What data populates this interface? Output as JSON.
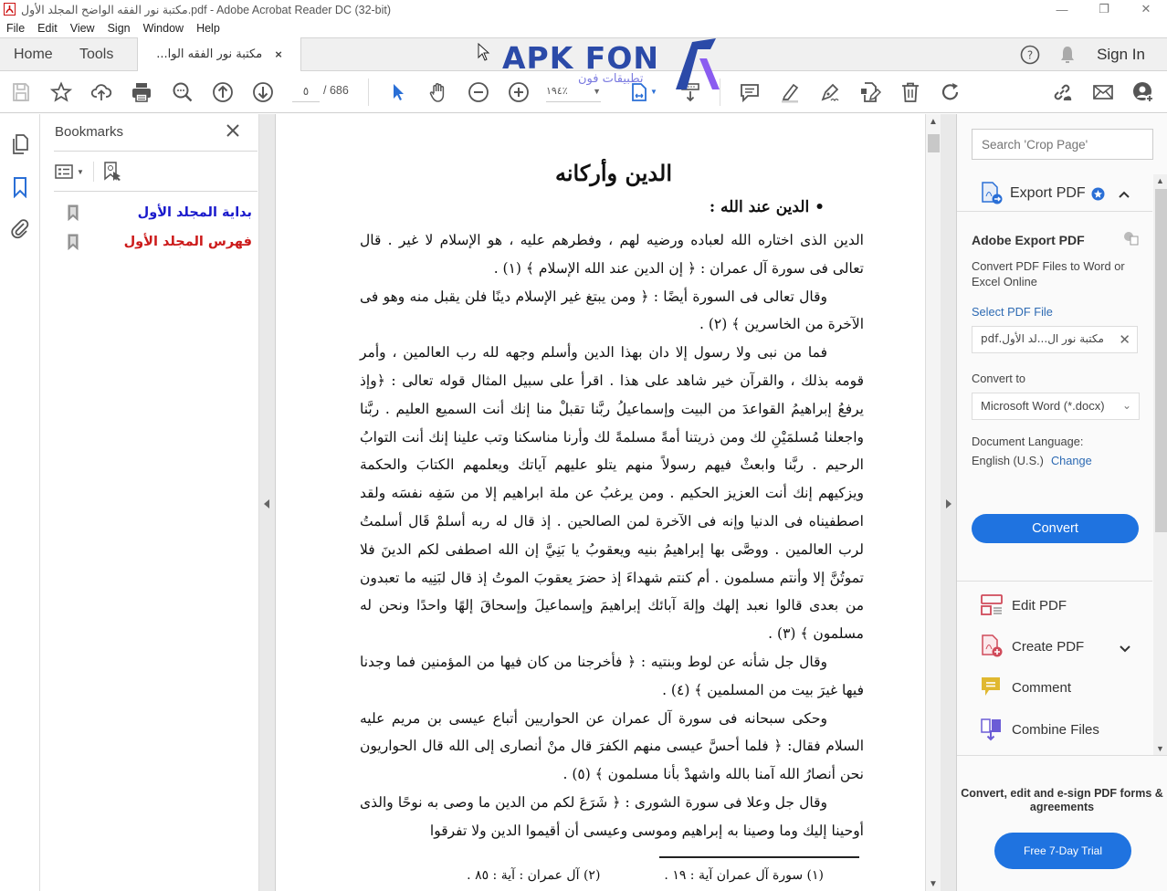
{
  "window": {
    "title": "مكتبة نور الفقه الواضح المجلد الأول.pdf - Adobe Acrobat Reader DC (32-bit)",
    "minimize": "—",
    "restore": "❐",
    "close": "✕"
  },
  "menu": [
    "File",
    "Edit",
    "View",
    "Sign",
    "Window",
    "Help"
  ],
  "tabs": {
    "home": "Home",
    "tools": "Tools",
    "document_tab": "مكتبة نور الفقه الوا...",
    "close": "×",
    "sign_in": "Sign In"
  },
  "toolbar": {
    "page_current": "٥",
    "page_total": "/ 686",
    "zoom_value": "١٩٤٪",
    "icons": [
      "save-icon",
      "bookmark-star-icon",
      "upload-cloud-icon",
      "print-icon",
      "find-icon",
      "page-up-icon",
      "page-down-icon",
      "select-arrow-icon",
      "hand-icon",
      "zoom-out-icon",
      "zoom-in-icon",
      "fit-page-icon",
      "scroll-mode-icon",
      "comment-icon",
      "highlight-icon",
      "sign-pen-icon",
      "edit-page-icon",
      "trash-icon",
      "rotate-icon",
      "share-link-icon",
      "email-icon",
      "add-user-icon"
    ]
  },
  "watermark": {
    "text": "APK FON",
    "subtext": "تطبيقات فون"
  },
  "bookmarks": {
    "title": "Bookmarks",
    "items": [
      {
        "label": "بداية المجلد الأول",
        "color": "#1a1acc"
      },
      {
        "label": "فهرس المجلد الأول",
        "color": "#cc1a1a"
      }
    ]
  },
  "document": {
    "heading": "الدين وأركانه",
    "subheading": "• الدين عند الله :",
    "paragraphs": [
      "الدين الذى اختاره الله لعباده ورضيه لهم ، وفطرهم عليه ، هو الإسلام لا غير . قال تعالى فى سورة آل عمران : ﴿ إن الدين عند الله الإسلام ﴾ (١) .",
      "وقال تعالى فى السورة أيضًا : ﴿ ومن يبتغ غير الإسلام دينًا فلن يقبل منه وهو فى الآخرة من الخاسرين ﴾ (٢) .",
      "فما من نبى ولا رسول إلا دان بهذا الدين وأسلم وجهه لله رب العالمين ، وأمر قومه بذلك ، والقرآن خير شاهد على هذا . اقرأ على سبيل المثال قوله تعالى : ﴿وإذ يرفعُ إبراهيمُ القواعدَ من البيت وإسماعيلُ ربَّنا تقبلْ منا إنك أنت السميع العليم . ربَّنا واجعلنا مُسلمَيْنِ لك ومن ذريتنا أمةً مسلمةً لك وأرنا مناسكنا وتب علينا إنك أنت التوابُ الرحيم . ربَّنا وابعثْ فيهم رسولاً منهم يتلو عليهم آياتك ويعلمهم الكتابَ والحكمة ويزكيهم إنك أنت العزيز الحكيم . ومن يرغبُ عن ملة ابراهيم إلا من سَفِه نفسَه ولقد اصطفيناه فى الدنيا وإنه فى الآخرة لمن الصالحين . إذ قال له ربه أسلمْ قَال أسلمتُ لرب العالمين . ووصَّى بها إبراهيمُ بنيه ويعقوبُ يا بَنِيَّ إن الله اصطفى لكم الدينَ فلا تموتُنَّ إلا وأنتم مسلمون . أم كنتم شهداءَ إذ حضرَ يعقوبَ الموتُ إذ قال لبَنِيه ما تعبدون من بعدى قالوا نعبد إلهك وإلهَ آبائك إبراهيمَ وإسماعيلَ وإسحاقَ إلهًا واحدًا ونحن له مسلمون ﴾ (٣) .",
      "وقال جل شأنه عن لوط وبنتيه : ﴿ فأخرجنا من كان فيها من المؤمنين فما وجدنا فيها غيرَ بيت من المسلمين ﴾ (٤) .",
      "وحكى سبحانه فى سورة آل عمران عن الحواريين أتباع عيسى بن مريم عليه السلام فقال: ﴿ فلما أحسَّ عيسى منهم الكفرَ قال منْ أنصارى إلى الله قال الحواريون نحن أنصارُ الله آمنا بالله واشهدْ بأنا مسلمون ﴾ (٥) .",
      "وقال جل وعلا فى سورة الشورى : ﴿ شَرَعَ لكم من الدين ما وصى به نوحًا والذى أوحينا إليك وما وصينا به إبراهيم وموسى وعيسى أن أقيموا الدين ولا تفرقوا"
    ],
    "footnotes": [
      "(١) سورة آل عمران آية : ١٩ .",
      "(٢) آل عمران : آية : ٨٥ ."
    ]
  },
  "right_pane": {
    "search_placeholder": "Search 'Crop Page'",
    "export_pdf": {
      "label": "Export PDF",
      "title": "Adobe Export PDF",
      "description": "Convert PDF Files to Word or Excel Online",
      "select_file_label": "Select PDF File",
      "file_name": "مكتبة نور ال...لد الأول.pdf",
      "convert_to_label": "Convert to",
      "convert_to_value": "Microsoft Word (*.docx)",
      "doc_language_label": "Document Language:",
      "doc_language_value": "English (U.S.)",
      "change_link": "Change",
      "convert_button": "Convert"
    },
    "tools": [
      {
        "label": "Edit PDF",
        "icon": "edit-pdf-icon"
      },
      {
        "label": "Create PDF",
        "icon": "create-pdf-icon"
      },
      {
        "label": "Comment",
        "icon": "comment-tool-icon"
      },
      {
        "label": "Combine Files",
        "icon": "combine-files-icon"
      }
    ],
    "promo_text": "Convert, edit and e-sign PDF forms & agreements",
    "trial_button": "Free 7-Day Trial"
  },
  "colors": {
    "accent_blue": "#1f73e0",
    "link_blue": "#2d6ab3",
    "bookmark_blue": "#1a1acc",
    "bookmark_red": "#cc1a1a"
  }
}
